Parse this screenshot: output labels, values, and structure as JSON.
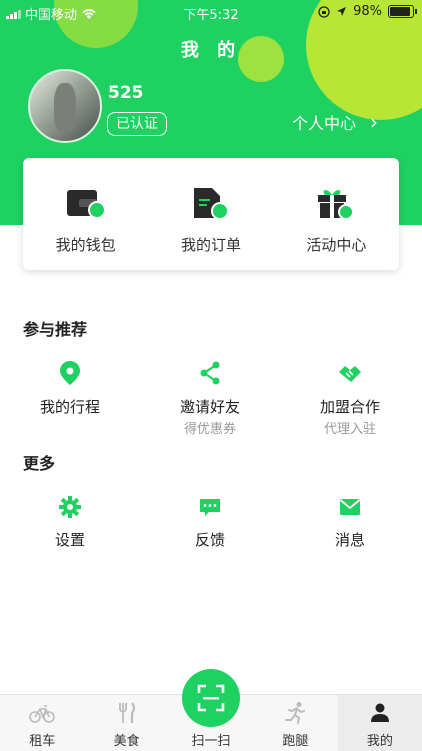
{
  "status_bar": {
    "carrier": "中国移动",
    "time": "下午5:32",
    "battery": "98%"
  },
  "header": {
    "title": "我 的"
  },
  "profile": {
    "username": "525",
    "verified_label": "已认证",
    "center_link": "个人中心",
    "chevron": "›"
  },
  "quick_actions": [
    {
      "label": "我的钱包",
      "icon": "wallet-icon"
    },
    {
      "label": "我的订单",
      "icon": "order-icon"
    },
    {
      "label": "活动中心",
      "icon": "gift-icon"
    }
  ],
  "recommend": {
    "title": "参与推荐",
    "items": [
      {
        "label": "我的行程",
        "sub": "",
        "icon": "location-pin-icon"
      },
      {
        "label": "邀请好友",
        "sub": "得优惠券",
        "icon": "share-icon"
      },
      {
        "label": "加盟合作",
        "sub": "代理入驻",
        "icon": "handshake-icon"
      }
    ]
  },
  "more": {
    "title": "更多",
    "items": [
      {
        "label": "设置",
        "icon": "gear-icon"
      },
      {
        "label": "反馈",
        "icon": "feedback-icon"
      },
      {
        "label": "消息",
        "icon": "envelope-icon"
      }
    ]
  },
  "tabbar": {
    "tabs": [
      {
        "label": "租车",
        "icon": "bicycle-icon",
        "active": false
      },
      {
        "label": "美食",
        "icon": "fork-knife-icon",
        "active": false
      },
      {
        "label": "扫一扫",
        "icon": "scan-icon",
        "active": false
      },
      {
        "label": "跑腿",
        "icon": "runner-icon",
        "active": false
      },
      {
        "label": "我的",
        "icon": "person-icon",
        "active": true
      }
    ]
  },
  "colors": {
    "brand_green": "#1fd160",
    "accent_lime": "#c9e832"
  }
}
